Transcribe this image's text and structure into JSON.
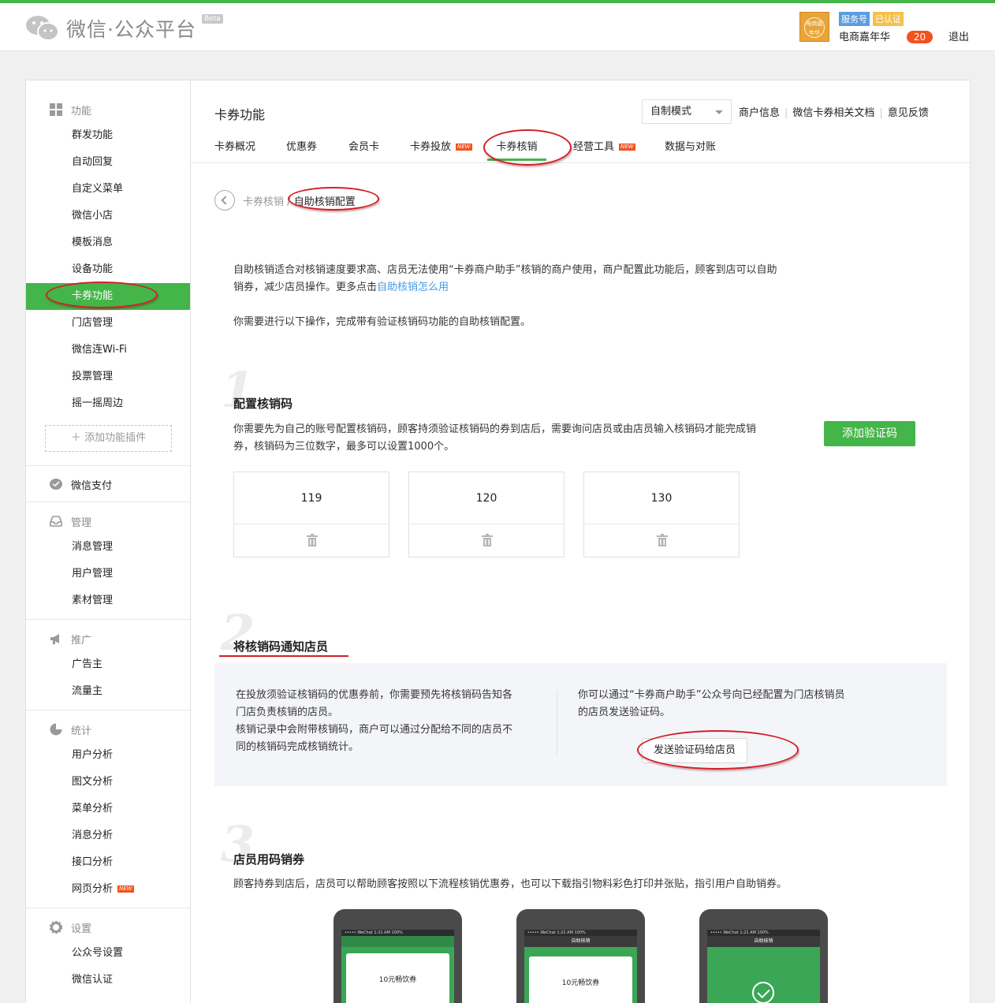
{
  "header": {
    "logo_text": "微信·公众平台",
    "beta": "Beta",
    "avatar_text": "电商嘉年华",
    "badge_service": "服务号",
    "badge_certified": "已认证",
    "account_name": "电商嘉年华",
    "message_count": "20",
    "logout": "退出"
  },
  "sidebar": {
    "func_title": "功能",
    "func_items": [
      "群发功能",
      "自动回复",
      "自定义菜单",
      "微信小店",
      "模板消息",
      "设备功能",
      "卡券功能",
      "门店管理",
      "微信连Wi-Fi",
      "投票管理",
      "摇一摇周边"
    ],
    "add_plugin": "添加功能插件",
    "pay_title": "微信支付",
    "manage_title": "管理",
    "manage_items": [
      "消息管理",
      "用户管理",
      "素材管理"
    ],
    "promo_title": "推广",
    "promo_items": [
      "广告主",
      "流量主"
    ],
    "stats_title": "统计",
    "stats_items": [
      "用户分析",
      "图文分析",
      "菜单分析",
      "消息分析",
      "接口分析",
      "网页分析"
    ],
    "settings_title": "设置",
    "settings_items": [
      "公众号设置",
      "微信认证"
    ],
    "new_tag": "NEW"
  },
  "main": {
    "title": "卡券功能",
    "mode_select": "自制模式",
    "links": [
      "商户信息",
      "微信卡券相关文档",
      "意见反馈"
    ],
    "tabs": [
      "卡券概况",
      "优惠券",
      "会员卡",
      "卡券投放",
      "卡券核销",
      "经营工具",
      "数据与对账"
    ],
    "new_tag": "NEW",
    "breadcrumb_parent": "卡券核销",
    "breadcrumb_sep": "/",
    "breadcrumb_current": "自助核销配置",
    "intro_line1": "自助核销适合对核销速度要求高、店员无法使用“卡券商户助手”核销的商户使用，商户配置此功能后，顾客到店可以自助",
    "intro_line2": "销券，减少店员操作。更多点击",
    "intro_link": "自助核销怎么用",
    "intro_line3": "你需要进行以下操作，完成带有验证核销码功能的自助核销配置。",
    "step1": {
      "num": "1",
      "title": "配置核销码",
      "desc_line1": "你需要先为自己的账号配置核销码，顾客持须验证核销码的券到店后，需要询问店员或由店员输入核销码才能完成销",
      "desc_line2": "券，核销码为三位数字，最多可以设置1000个。",
      "button": "添加验证码",
      "codes": [
        "119",
        "120",
        "130"
      ]
    },
    "step2": {
      "num": "2",
      "title": "将核销码通知店员",
      "left_line1": "在投放须验证核销码的优惠券前，你需要预先将核销码告知各",
      "left_line2": "门店负责核销的店员。",
      "left_line3": "核销记录中会附带核销码，商户可以通过分配给不同的店员不",
      "left_line4": "同的核销码完成核销统计。",
      "right_line1": "你可以通过“卡券商户助手”公众号向已经配置为门店核销员",
      "right_line2": "的店员发送验证码。",
      "button": "发送验证码给店员"
    },
    "step3": {
      "num": "3",
      "title": "店员用码销券",
      "desc": "顾客持券到店后，店员可以帮助顾客按照以下流程核销优惠券，也可以下载指引物料彩色打印并张贴，指引用户自助销券。",
      "phones": [
        {
          "status": "••••• WeChat  1:21 AM  100%",
          "nav": "",
          "card_text": "10元畅饮券"
        },
        {
          "status": "••••• WeChat  1:21 AM  100%",
          "nav": "自助核销",
          "card_text": "10元畅饮券"
        },
        {
          "status": "••••• WeChat  1:21 AM  100%",
          "nav": "自助核销",
          "card_text": ""
        }
      ]
    }
  },
  "colors": {
    "brand_green": "#44b549",
    "annotation_red": "#d0202a",
    "link_blue": "#459ae9",
    "badge_red": "#f4511e"
  }
}
